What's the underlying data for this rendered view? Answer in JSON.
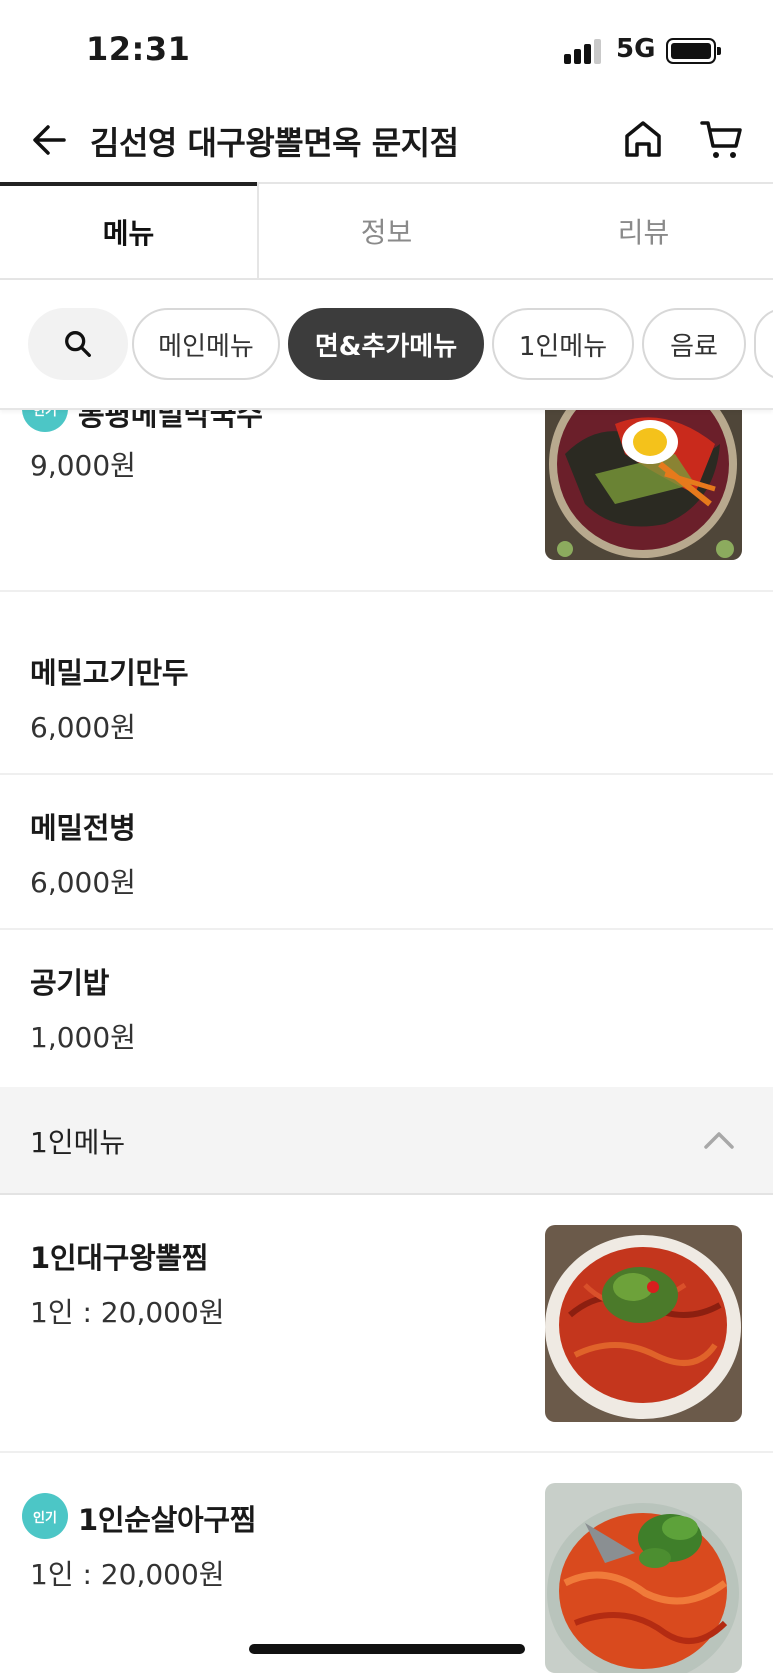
{
  "status": {
    "time": "12:31",
    "network": "5G",
    "battery": 0.95
  },
  "header": {
    "title": "김선영 대구왕뽈면옥 문지점"
  },
  "tabs": [
    {
      "label": "메뉴",
      "active": true
    },
    {
      "label": "정보",
      "active": false
    },
    {
      "label": "리뷰",
      "active": false
    }
  ],
  "categories": [
    {
      "label": "메인메뉴",
      "active": false
    },
    {
      "label": "면&추가메뉴",
      "active": true
    },
    {
      "label": "1인메뉴",
      "active": false
    },
    {
      "label": "음료",
      "active": false
    }
  ],
  "menu_items": [
    {
      "name": "봉평메밀막국수",
      "price": "9,000원",
      "badge": "인기"
    },
    {
      "name": "메밀고기만두",
      "price": "6,000원"
    },
    {
      "name": "메밀전병",
      "price": "6,000원"
    },
    {
      "name": "공기밥",
      "price": "1,000원"
    }
  ],
  "section": {
    "title": "1인메뉴"
  },
  "solo_items": [
    {
      "name": "1인대구왕뽈찜",
      "price": "1인 : 20,000원"
    },
    {
      "name": "1인순살아구찜",
      "price": "1인 : 20,000원",
      "badge": "인기"
    }
  ],
  "colors": {
    "badge": "#4cc6c6",
    "active_chip": "#3c3c3c",
    "section_bg": "#f4f4f4"
  }
}
